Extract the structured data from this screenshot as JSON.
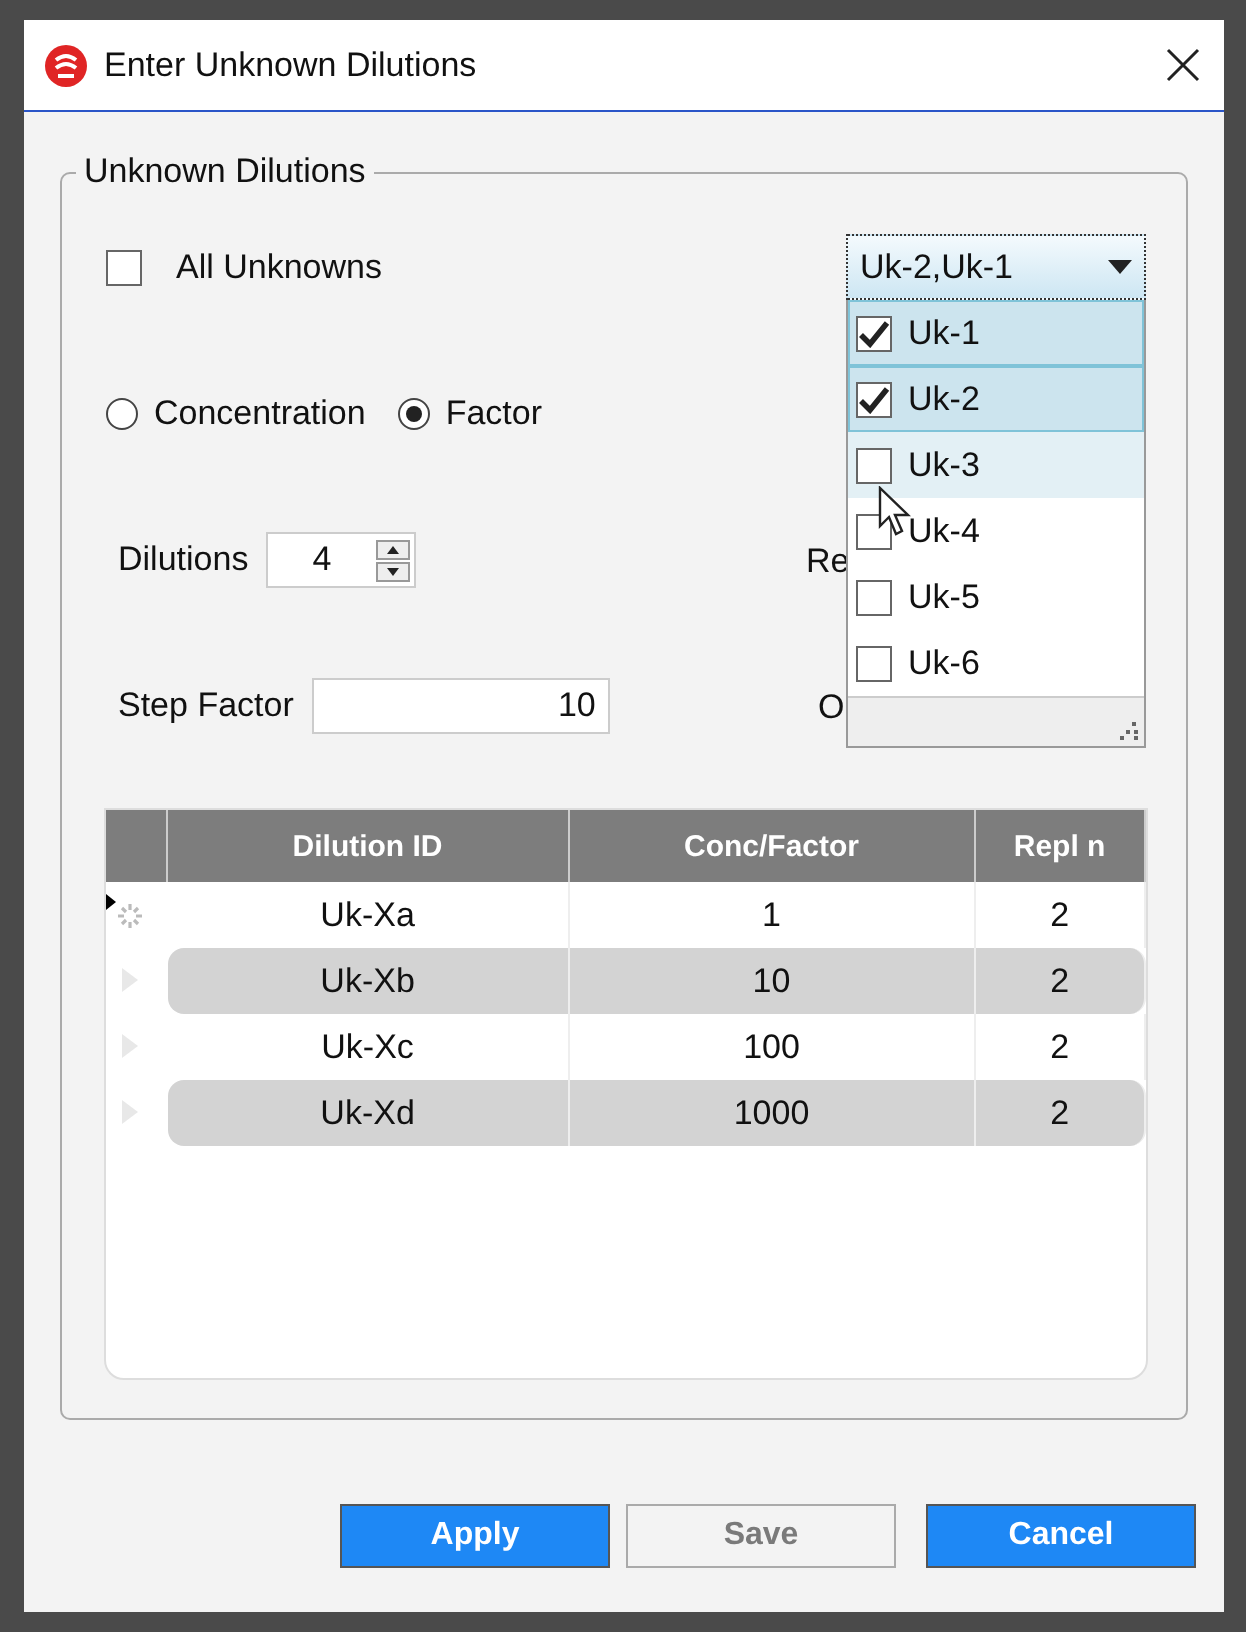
{
  "window": {
    "title": "Enter Unknown Dilutions"
  },
  "group": {
    "title": "Unknown Dilutions"
  },
  "all_unknowns": {
    "label": "All Unknowns",
    "checked": false
  },
  "mode_radios": [
    {
      "label": "Concentration",
      "selected": false
    },
    {
      "label": "Factor",
      "selected": true
    }
  ],
  "dilutions": {
    "label": "Dilutions",
    "value": "4"
  },
  "step_factor": {
    "label": "Step Factor",
    "value": "10"
  },
  "covered_labels": [
    "Re",
    "O"
  ],
  "unknowns_dropdown": {
    "value": "Uk-2,Uk-1",
    "expanded": true,
    "items": [
      {
        "label": "Uk-1",
        "checked": true,
        "selected": true,
        "hovered": false
      },
      {
        "label": "Uk-2",
        "checked": true,
        "selected": true,
        "hovered": false
      },
      {
        "label": "Uk-3",
        "checked": false,
        "selected": false,
        "hovered": true
      },
      {
        "label": "Uk-4",
        "checked": false,
        "selected": false,
        "hovered": false
      },
      {
        "label": "Uk-5",
        "checked": false,
        "selected": false,
        "hovered": false
      },
      {
        "label": "Uk-6",
        "checked": false,
        "selected": false,
        "hovered": false
      }
    ]
  },
  "table": {
    "columns": [
      "Dilution ID",
      "Conc/Factor",
      "Repl n"
    ],
    "rows": [
      {
        "current": true,
        "cells": [
          "Uk-Xa",
          "1",
          "2"
        ]
      },
      {
        "current": false,
        "cells": [
          "Uk-Xb",
          "10",
          "2"
        ]
      },
      {
        "current": false,
        "cells": [
          "Uk-Xc",
          "100",
          "2"
        ]
      },
      {
        "current": false,
        "cells": [
          "Uk-Xd",
          "1000",
          "2"
        ]
      }
    ]
  },
  "buttons": [
    {
      "label": "Apply",
      "disabled": false
    },
    {
      "label": "Save",
      "disabled": true
    },
    {
      "label": "Cancel",
      "disabled": false
    }
  ]
}
